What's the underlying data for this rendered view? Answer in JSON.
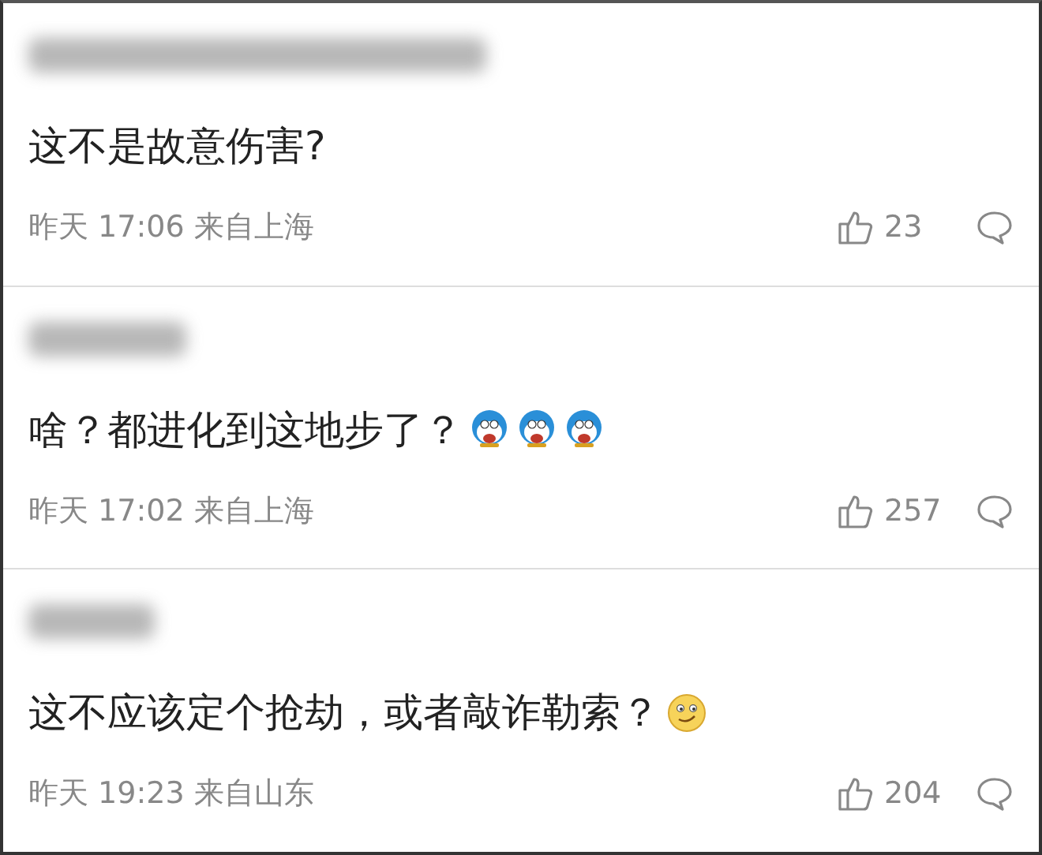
{
  "comments": [
    {
      "name_hidden": true,
      "text": "这不是故意伤害?",
      "time": "昨天 17:06",
      "location": "来自上海",
      "likes": "23"
    },
    {
      "name_hidden": true,
      "text": "啥？都进化到这地步了？",
      "emojis": [
        {
          "kind": "blue-cat"
        },
        {
          "kind": "blue-cat"
        },
        {
          "kind": "blue-cat"
        }
      ],
      "time": "昨天 17:02",
      "location": "来自上海",
      "likes": "257"
    },
    {
      "name_hidden": true,
      "text": "这不应该定个抢劫，或者敲诈勒索？",
      "emojis": [
        {
          "kind": "smirk"
        }
      ],
      "time": "昨天 19:23",
      "location": "来自山东",
      "likes": "204"
    }
  ]
}
